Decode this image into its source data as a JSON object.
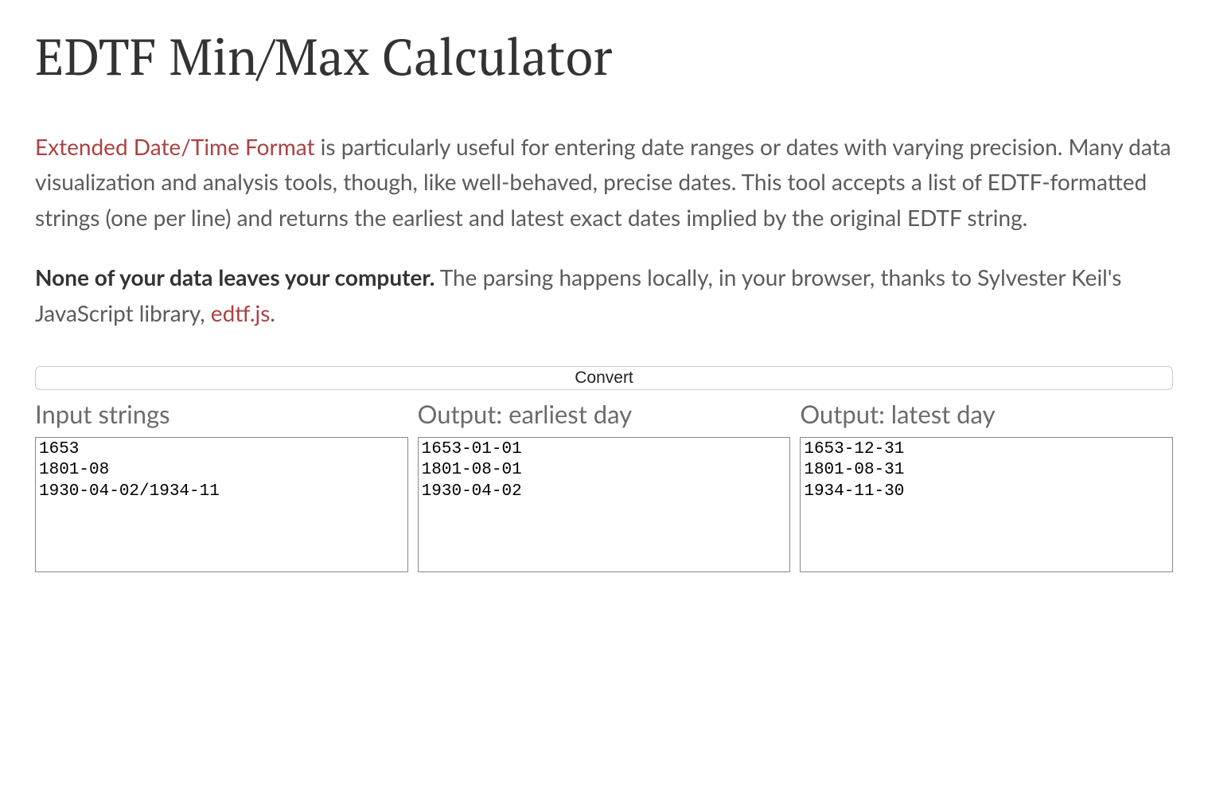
{
  "title": "EDTF Min/Max Calculator",
  "intro": {
    "link_text": "Extended Date/Time Format",
    "body": " is particularly useful for entering date ranges or dates with varying precision. Many data visualization and analysis tools, though, like well-behaved, precise dates. This tool accepts a list of EDTF-formatted strings (one per line) and returns the earliest and latest exact dates implied by the original EDTF string."
  },
  "privacy": {
    "strong": "None of your data leaves your computer.",
    "body": " The parsing happens locally, in your browser, thanks to Sylvester Keil's JavaScript library, ",
    "link_text": "edtf.js",
    "after_link": "."
  },
  "convert_label": "Convert",
  "columns": {
    "input": {
      "header": "Input strings",
      "value": "1653\n1801-08\n1930-04-02/1934-11"
    },
    "earliest": {
      "header": "Output: earliest day",
      "value": "1653-01-01\n1801-08-01\n1930-04-02"
    },
    "latest": {
      "header": "Output: latest day",
      "value": "1653-12-31\n1801-08-31\n1934-11-30"
    }
  }
}
